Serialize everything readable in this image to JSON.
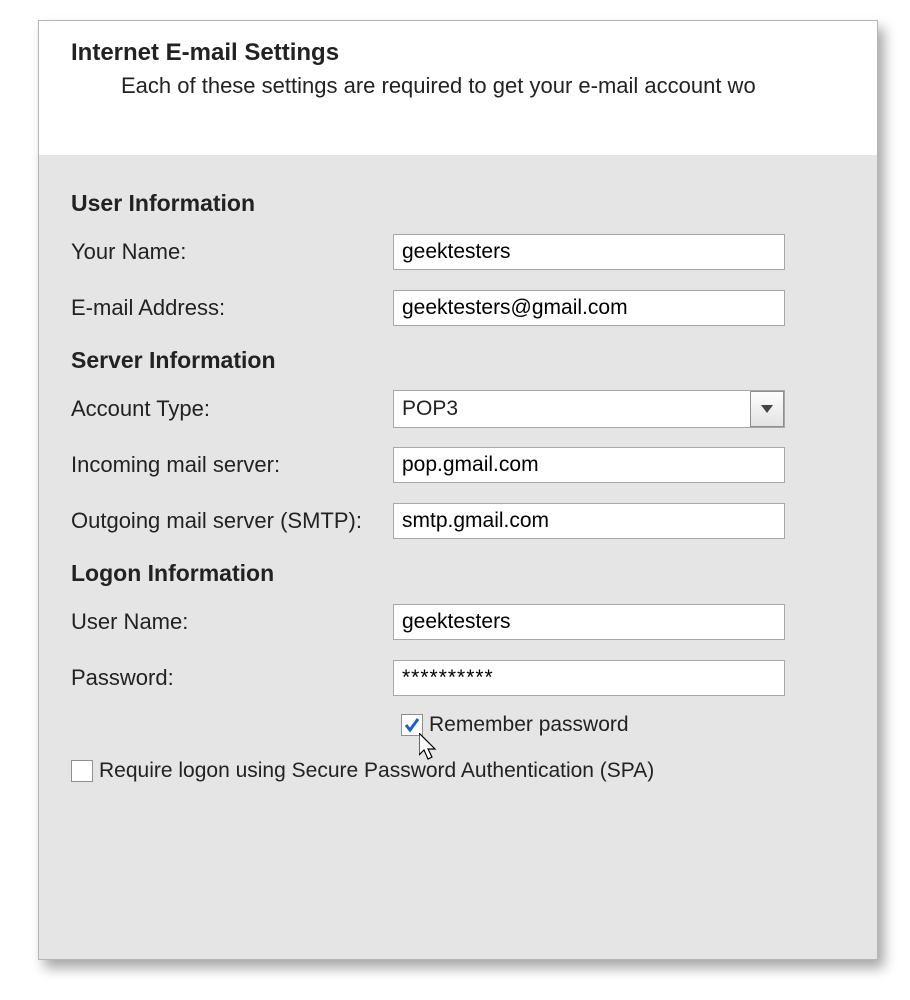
{
  "header": {
    "title": "Internet E-mail Settings",
    "subtitle": "Each of these settings are required to get your e-mail account wo"
  },
  "sections": {
    "user_info_heading": "User Information",
    "server_info_heading": "Server Information",
    "logon_info_heading": "Logon Information"
  },
  "labels": {
    "your_name": "Your Name:",
    "email_address": "E-mail Address:",
    "account_type": "Account Type:",
    "incoming_server": "Incoming mail server:",
    "outgoing_server": "Outgoing mail server (SMTP):",
    "user_name": "User Name:",
    "password": "Password:",
    "remember_password": "Remember password",
    "require_spa": "Require logon using Secure Password Authentication (SPA)"
  },
  "values": {
    "your_name": "geektesters",
    "email_address": "geektesters@gmail.com",
    "account_type": "POP3",
    "incoming_server": "pop.gmail.com",
    "outgoing_server": "smtp.gmail.com",
    "user_name": "geektesters",
    "password_masked": "**********"
  },
  "checkboxes": {
    "remember_password_checked": true,
    "require_spa_checked": false
  }
}
